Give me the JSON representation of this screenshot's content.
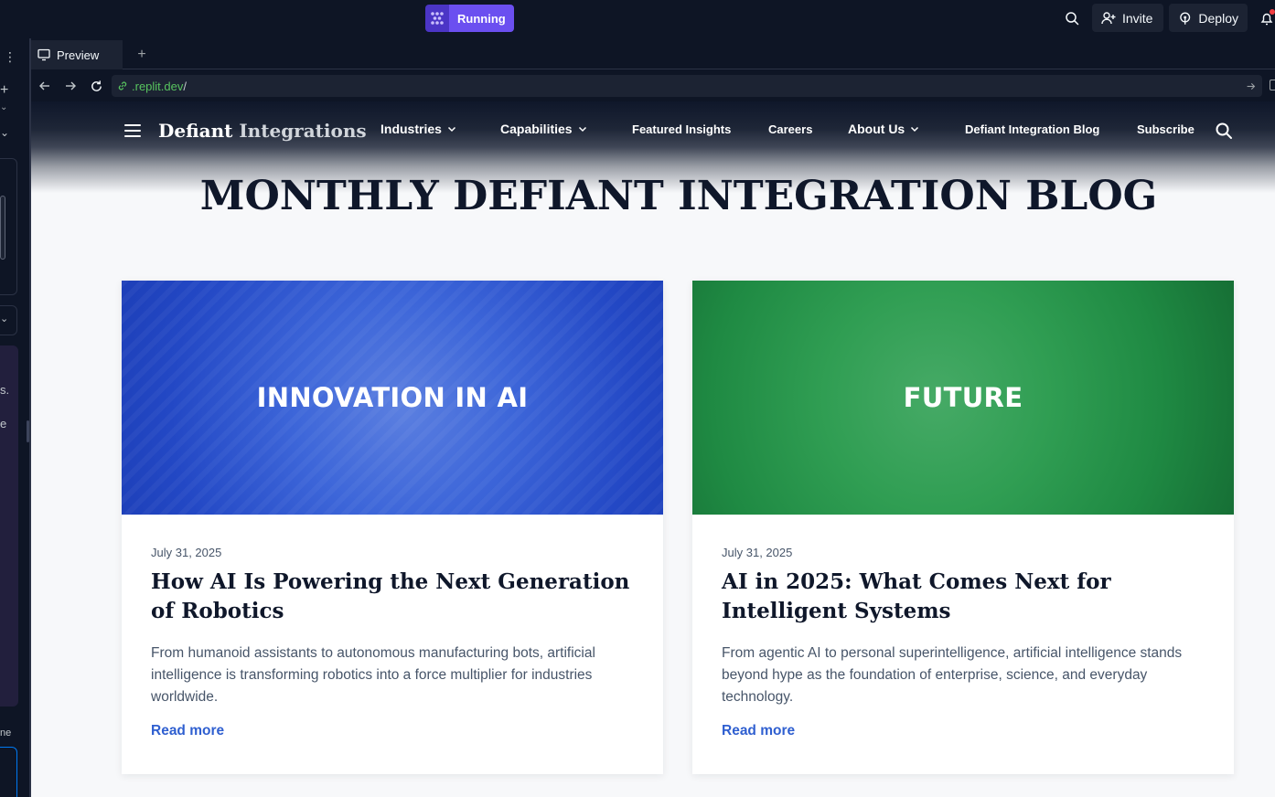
{
  "topbar": {
    "run_status": "Running",
    "invite_label": "Invite",
    "deploy_label": "Deploy"
  },
  "leftpanel": {
    "frag_1": "s.",
    "frag_2": "e",
    "frag_3": "ne"
  },
  "pane": {
    "tab_label": "Preview",
    "url_host": ".replit.dev",
    "url_path": "/"
  },
  "site": {
    "brand_part1": "Defiant",
    "brand_part2": "Integrations",
    "nav": [
      {
        "label": "Industries",
        "has_dropdown": true
      },
      {
        "label": "Capabilities",
        "has_dropdown": true
      },
      {
        "label": "Featured Insights",
        "has_dropdown": false
      },
      {
        "label": "Careers",
        "has_dropdown": false
      },
      {
        "label": "About Us",
        "has_dropdown": true
      },
      {
        "label": "Defiant Integration Blog",
        "has_dropdown": false
      },
      {
        "label": "Subscribe",
        "has_dropdown": false
      }
    ],
    "page_title": "MONTHLY DEFIANT INTEGRATION BLOG",
    "posts": [
      {
        "hero_text": "INNOVATION IN AI",
        "hero_color": "#2f57d0",
        "date": "July 31, 2025",
        "title": "How AI Is Powering the Next Generation of Robotics",
        "excerpt": "From humanoid assistants to autonomous manufacturing bots, artificial intelligence is transforming robotics into a force multiplier for industries worldwide.",
        "link": "Read more"
      },
      {
        "hero_text": "FUTURE",
        "hero_color": "#22914a",
        "date": "July 31, 2025",
        "title": "AI in 2025: What Comes Next for Intelligent Systems",
        "excerpt": "From agentic AI to personal superintelligence, artificial intelligence stands beyond hype as the foundation of enterprise, science, and everyday technology.",
        "link": "Read more"
      }
    ]
  },
  "colors": {
    "replit_bg": "#0e1525",
    "running_badge": "#6b4ff0",
    "link_blue": "#2f5fd0",
    "url_green": "#58c45f"
  }
}
